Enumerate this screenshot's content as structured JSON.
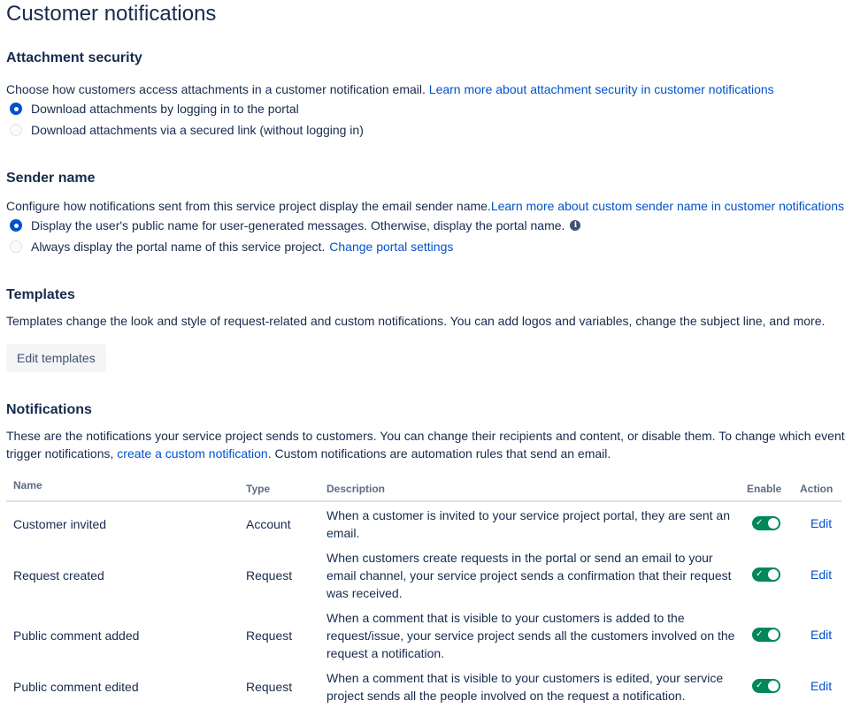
{
  "page": {
    "title": "Customer notifications"
  },
  "attachment": {
    "heading": "Attachment security",
    "description": "Choose how customers access attachments in a customer notification email.",
    "learn_more": "Learn more about attachment security in customer notifications",
    "options": [
      {
        "label": "Download attachments by logging in to the portal",
        "selected": true
      },
      {
        "label": "Download attachments via a secured link (without logging in)",
        "selected": false
      }
    ]
  },
  "sender": {
    "heading": "Sender name",
    "description": "Configure how notifications sent from this service project display the email sender name.",
    "learn_more": "Learn more about custom sender name in customer notifications",
    "options": [
      {
        "label": "Display the user's public name for user-generated messages. Otherwise, display the portal name.",
        "selected": true
      },
      {
        "label": "Always display the portal name of this service project.",
        "selected": false,
        "link": "Change portal settings"
      }
    ],
    "info_glyph": "i"
  },
  "templates": {
    "heading": "Templates",
    "description": "Templates change the look and style of request-related and custom notifications. You can add logos and variables, change the subject line, and more.",
    "button": "Edit templates"
  },
  "notifications": {
    "heading": "Notifications",
    "desc_line1": "These are the notifications your service project sends to customers. You can change their recipients and content, or disable them. To change which events",
    "desc_line2_a": "trigger notifications,",
    "desc_link": "create a custom notification",
    "desc_line2_b": ". Custom notifications are automation rules that send an email.",
    "columns": {
      "name": "Name",
      "type": "Type",
      "description": "Description",
      "enable": "Enable",
      "action": "Action"
    },
    "rows": [
      {
        "name": "Customer invited",
        "type": "Account",
        "description": "When a customer is invited to your service project portal, they are sent an email.",
        "enabled": true,
        "action": "Edit"
      },
      {
        "name": "Request created",
        "type": "Request",
        "description": "When customers create requests in the portal or send an email to your email channel, your service project sends a confirmation that their request was received.",
        "enabled": true,
        "action": "Edit"
      },
      {
        "name": "Public comment added",
        "type": "Request",
        "description": "When a comment that is visible to your customers is added to the request/issue, your service project sends all the customers involved on the request a notification.",
        "enabled": true,
        "action": "Edit"
      },
      {
        "name": "Public comment edited",
        "type": "Request",
        "description": "When a comment that is visible to your customers is edited, your service project sends all the people involved on the request a notification.",
        "enabled": true,
        "action": "Edit"
      }
    ]
  },
  "colors": {
    "link": "#0052cc",
    "toggle_on": "#00875a",
    "radio_on": "#0052cc",
    "text": "#172b4d"
  }
}
